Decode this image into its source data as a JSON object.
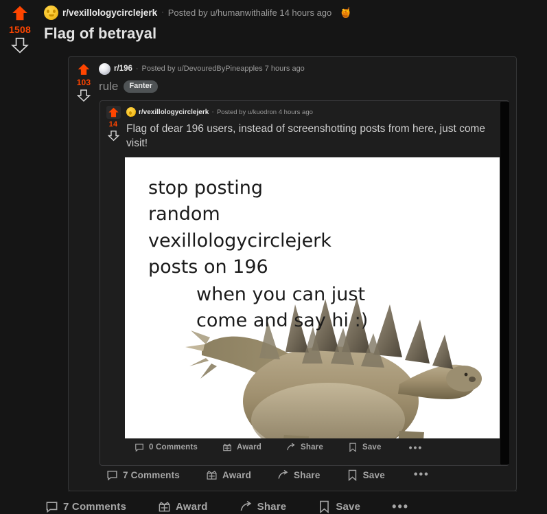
{
  "theme": {
    "page_bg": "#151515",
    "card_bg_mid": "#1b1b1b",
    "card_bg_inner": "#1e1e1e",
    "upvote_orange": "#ff4500",
    "text_primary": "#e3e3e3",
    "text_muted": "#9a9a9a",
    "flair_bg": "#4f5355"
  },
  "outer_post": {
    "vote": {
      "score": "1508",
      "upvote_icon": "arrow-up-icon",
      "downvote_icon": "arrow-down-icon",
      "upvoted": true
    },
    "avatar_icon": "moon-face-avatar",
    "subreddit": "r/vexillologycirclejerk",
    "separator": "·",
    "meta": "Posted by u/humanwithalife 14 hours ago",
    "award_icon": "award-badge-icon",
    "award_glyph": "🍯",
    "title": "Flag of betrayal",
    "actions": [
      {
        "icon": "comment-icon",
        "label": "7 Comments"
      },
      {
        "icon": "award-icon",
        "label": "Award"
      },
      {
        "icon": "share-icon",
        "label": "Share"
      },
      {
        "icon": "save-icon",
        "label": "Save"
      },
      {
        "icon": "more-options-icon",
        "label": "•••"
      }
    ]
  },
  "mid_post": {
    "vote": {
      "score": "103",
      "upvote_icon": "arrow-up-icon",
      "downvote_icon": "arrow-down-icon",
      "upvoted": true
    },
    "avatar_icon": "sphere-avatar",
    "subreddit": "r/196",
    "separator": "·",
    "meta": "Posted by u/DevouredByPineapples 7 hours ago",
    "title": "rule",
    "flair": "Fanter",
    "actions": [
      {
        "icon": "comment-icon",
        "label": "7 Comments"
      },
      {
        "icon": "award-icon",
        "label": "Award"
      },
      {
        "icon": "share-icon",
        "label": "Share"
      },
      {
        "icon": "save-icon",
        "label": "Save"
      },
      {
        "icon": "more-options-icon",
        "label": "•••"
      }
    ]
  },
  "inner_post": {
    "vote": {
      "score": "14",
      "upvote_icon": "arrow-up-icon",
      "downvote_icon": "arrow-down-icon",
      "upvoted": true
    },
    "avatar_icon": "moon-face-avatar",
    "subreddit": "r/vexillologycirclejerk",
    "separator": "·",
    "meta": "Posted by u/kuodron 4 hours ago",
    "title": "Flag of dear 196 users, instead of screenshotting posts from here, just come visit!",
    "actions": [
      {
        "icon": "comment-icon",
        "label": "0 Comments"
      },
      {
        "icon": "award-icon",
        "label": "Award"
      },
      {
        "icon": "share-icon",
        "label": "Share"
      },
      {
        "icon": "save-icon",
        "label": "Save"
      },
      {
        "icon": "more-options-icon",
        "label": "•••"
      }
    ]
  },
  "meme_image": {
    "alt": "stegosaurus-meme-image",
    "background": "#ffffff",
    "line_block_1": "stop posting\nrandom\nvexillologycirclejerk\nposts on 196",
    "line_block_2": "when you can just\ncome and say hi :)",
    "subject_icon": "stegosaurus-illustration"
  }
}
